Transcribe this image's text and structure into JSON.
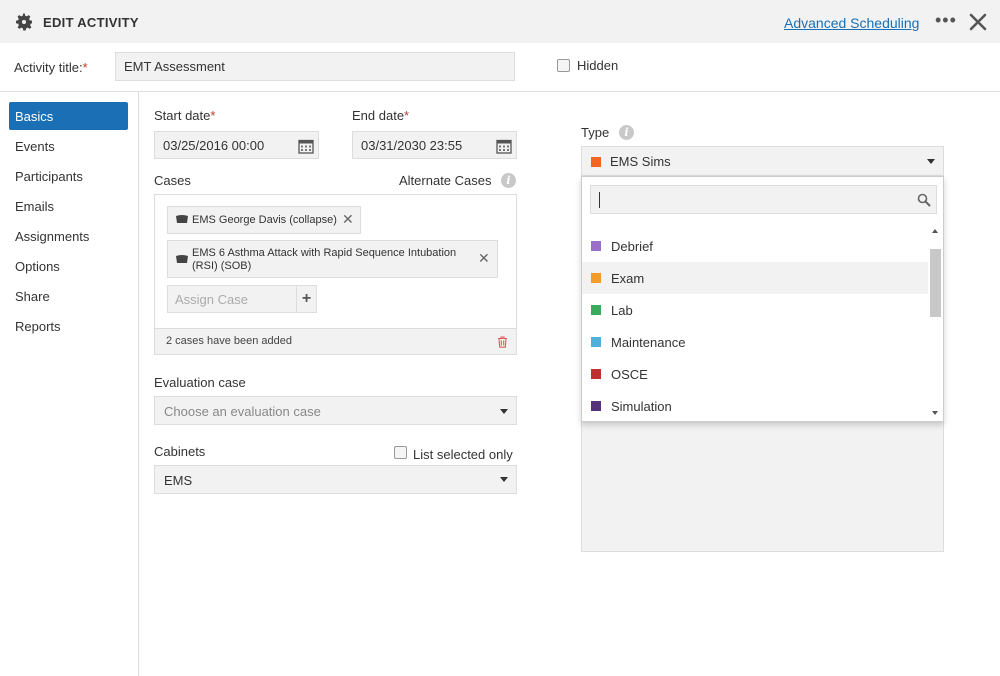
{
  "header": {
    "title": "EDIT ACTIVITY",
    "advanced_link": "Advanced Scheduling",
    "more_icon": "ellipsis-icon",
    "close_icon": "close-icon",
    "settings_icon": "gear-icon"
  },
  "activity": {
    "title_label": "Activity title:",
    "required_mark": "*",
    "title_value": "EMT Assessment",
    "hidden_label": "Hidden",
    "hidden_checked": false
  },
  "sidebar": {
    "items": [
      {
        "label": "Basics",
        "active": true
      },
      {
        "label": "Events"
      },
      {
        "label": "Participants"
      },
      {
        "label": "Emails"
      },
      {
        "label": "Assignments"
      },
      {
        "label": "Options"
      },
      {
        "label": "Share"
      },
      {
        "label": "Reports"
      }
    ]
  },
  "dates": {
    "start_label": "Start date",
    "start_value": "03/25/2016 00:00",
    "end_label": "End date",
    "end_value": "03/31/2030 23:55"
  },
  "cases": {
    "label": "Cases",
    "alternate_label": "Alternate Cases",
    "chips": [
      {
        "line1": "EMS George Davis (collapse)"
      },
      {
        "line1": "EMS 6 Asthma Attack with Rapid Sequence Intubation",
        "line2": "(RSI) (SOB)"
      }
    ],
    "assign_placeholder": "Assign Case",
    "footer_text": "2 cases have been added"
  },
  "evaluation": {
    "label": "Evaluation case",
    "placeholder": "Choose an evaluation case"
  },
  "cabinets": {
    "label": "Cabinets",
    "list_selected_label": "List selected only",
    "value": "EMS"
  },
  "type": {
    "label": "Type",
    "selected": "EMS Sims",
    "selected_color": "#f26522",
    "options": [
      {
        "label": "Debrief",
        "color": "#9b6fc7"
      },
      {
        "label": "Exam",
        "color": "#f39c2a",
        "highlighted": true
      },
      {
        "label": "Lab",
        "color": "#3aaa5c"
      },
      {
        "label": "Maintenance",
        "color": "#4fb0d9"
      },
      {
        "label": "OSCE",
        "color": "#c0302f"
      },
      {
        "label": "Simulation",
        "color": "#55337a"
      }
    ]
  },
  "colors": {
    "accent": "#1a6fb5",
    "required": "#c0392b",
    "trash": "#e05a5a"
  }
}
